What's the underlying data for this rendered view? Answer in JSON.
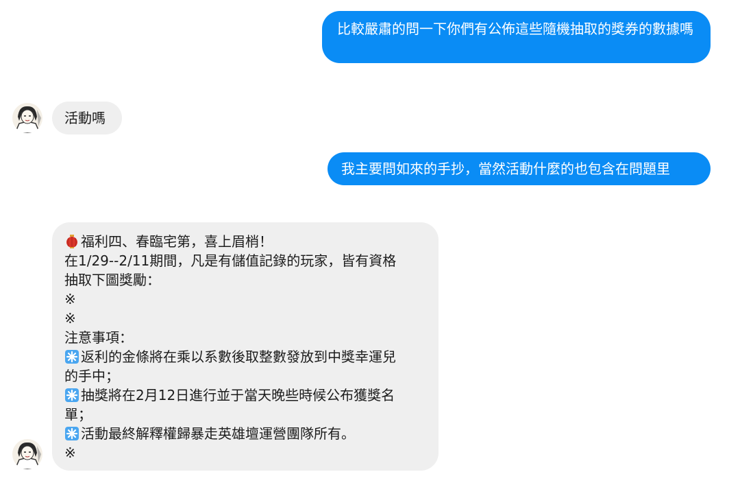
{
  "messages": [
    {
      "direction": "outgoing",
      "text": "比較嚴肅的問一下你們有公佈這些隨機抽取的獎券的數據嗎"
    },
    {
      "direction": "incoming",
      "text": "活動嗎"
    },
    {
      "direction": "outgoing",
      "text": "我主要問如來的手抄，當然活動什麼的也包含在問題里"
    },
    {
      "direction": "incoming",
      "lines": [
        {
          "icon": "red-lantern-icon",
          "text": "福利四、春臨宅第，喜上眉梢！"
        },
        {
          "text": "在1/29--2/11期間，凡是有儲值記錄的玩家，皆有資格"
        },
        {
          "text": "抽取下圖獎勵："
        },
        {
          "text": "※"
        },
        {
          "text": "※"
        },
        {
          "text": "注意事項："
        },
        {
          "icon": "asterisk-icon",
          "text": "返利的金條將在乘以系數後取整數發放到中獎幸運兒"
        },
        {
          "text": "的手中；"
        },
        {
          "icon": "asterisk-icon",
          "text": "抽獎將在2月12日進行並于當天晚些時候公布獲獎名"
        },
        {
          "text": "單；"
        },
        {
          "icon": "asterisk-icon",
          "text": "活動最終解釋權歸暴走英雄壇運營團隊所有。"
        },
        {
          "text": "※"
        }
      ]
    }
  ],
  "colors": {
    "outgoing_bubble": "#0a8cf5",
    "incoming_bubble": "#efefef",
    "asterisk_icon": "#4aa6f0",
    "lantern_icon": "#d8352a"
  }
}
